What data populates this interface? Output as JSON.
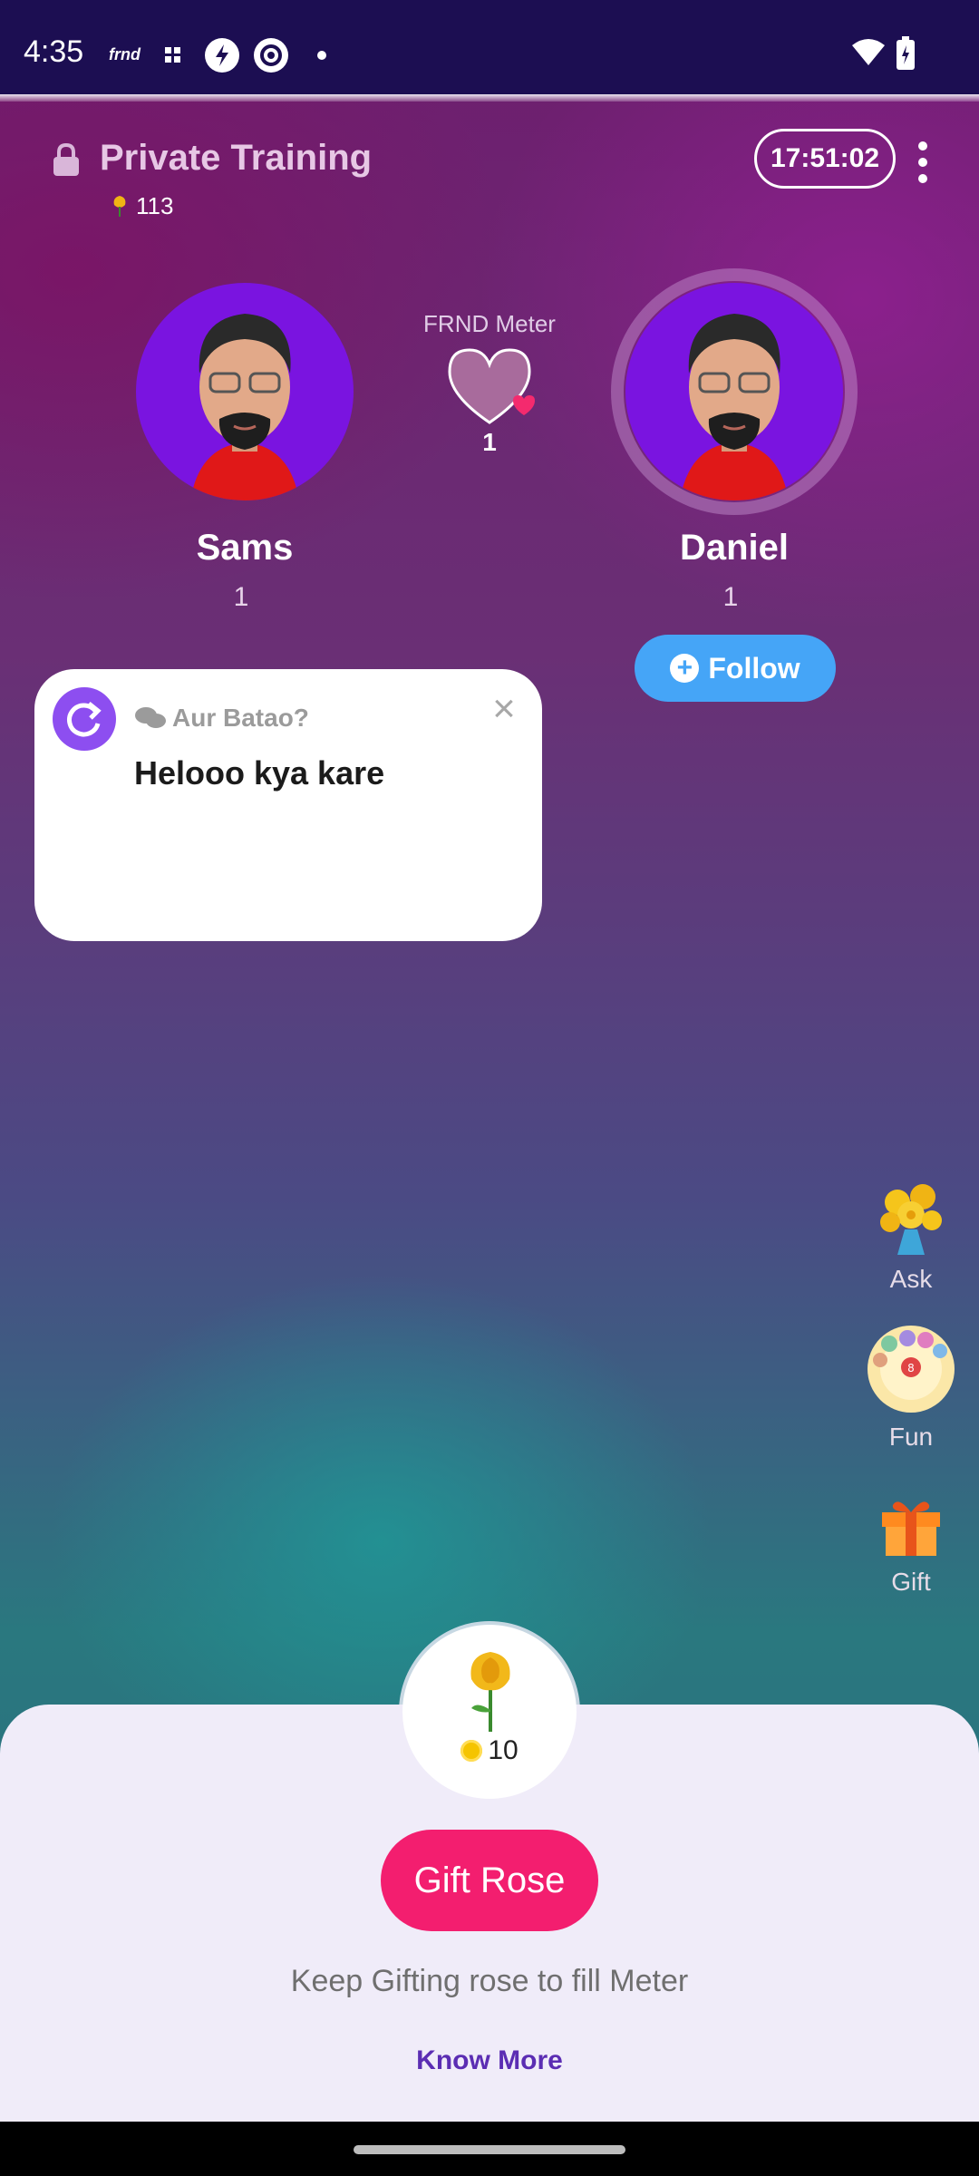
{
  "status_bar": {
    "time": "4:35",
    "app_icon_text": "frnd"
  },
  "header": {
    "title": "Private Training",
    "rose_count": "113",
    "timer": "17:51:02"
  },
  "users": [
    {
      "name": "Sams",
      "count": "1"
    },
    {
      "name": "Daniel",
      "count": "1"
    }
  ],
  "meter": {
    "label": "FRND Meter",
    "value": "1"
  },
  "follow_label": "Follow",
  "prompt_card": {
    "label": "Aur Batao?",
    "message": "Helooo kya kare"
  },
  "side_actions": [
    {
      "label": "Ask",
      "icon": "bouquet-icon"
    },
    {
      "label": "Fun",
      "icon": "fun-game-icon"
    },
    {
      "label": "Gift",
      "icon": "gift-icon"
    }
  ],
  "gift_sheet": {
    "price": "10",
    "button_label": "Gift Rose",
    "hint": "Keep Gifting rose to fill Meter",
    "link": "Know More"
  },
  "colors": {
    "accent_pink": "#f31e6f",
    "follow_blue": "#45a5f7",
    "link_purple": "#5b2db3",
    "avatar_purple": "#7a14e0"
  }
}
